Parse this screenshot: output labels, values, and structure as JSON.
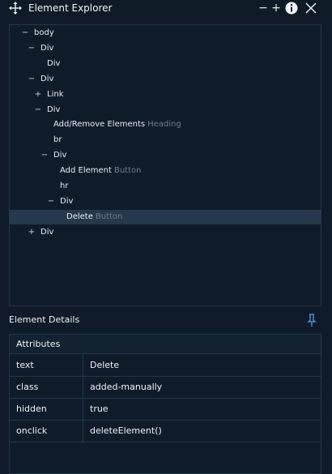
{
  "window": {
    "title": "Element Explorer",
    "controls": {
      "minimize": "−",
      "maximize": "+",
      "info": "i",
      "close": "✕"
    },
    "icon": "move-icon"
  },
  "tree": {
    "nodes": [
      {
        "toggle": "−",
        "label": "body",
        "hint": "",
        "depth": 0
      },
      {
        "toggle": "−",
        "label": "Div",
        "hint": "",
        "depth": 1
      },
      {
        "toggle": "",
        "label": "Div",
        "hint": "",
        "depth": 2
      },
      {
        "toggle": "−",
        "label": "Div",
        "hint": "",
        "depth": 1
      },
      {
        "toggle": "+",
        "label": "Link",
        "hint": "",
        "depth": 2
      },
      {
        "toggle": "−",
        "label": "Div",
        "hint": "",
        "depth": 2
      },
      {
        "toggle": "",
        "label": "Add/Remove Elements",
        "hint": "Heading",
        "depth": 3
      },
      {
        "toggle": "",
        "label": "br",
        "hint": "",
        "depth": 3
      },
      {
        "toggle": "−",
        "label": "Div",
        "hint": "",
        "depth": 3
      },
      {
        "toggle": "",
        "label": "Add Element",
        "hint": "Button",
        "depth": 4
      },
      {
        "toggle": "",
        "label": "hr",
        "hint": "",
        "depth": 4
      },
      {
        "toggle": "−",
        "label": "Div",
        "hint": "",
        "depth": 4
      },
      {
        "toggle": "",
        "label": "Delete",
        "hint": "Button",
        "depth": 5,
        "selected": true
      },
      {
        "toggle": "+",
        "label": "Div",
        "hint": "",
        "depth": 1
      }
    ]
  },
  "details": {
    "title": "Element Details",
    "pin_icon": "pin-icon",
    "attributes_title": "Attributes",
    "attributes": [
      {
        "key": "text",
        "value": "Delete"
      },
      {
        "key": "class",
        "value": "added-manually"
      },
      {
        "key": "hidden",
        "value": "true"
      },
      {
        "key": "onclick",
        "value": "deleteElement()"
      }
    ]
  },
  "colors": {
    "background": "#0f1b28",
    "panel": "#0e1c2a",
    "selected_row": "#26384b",
    "hint_text": "#6f7d8b",
    "pin_accent": "#4a90d9"
  }
}
